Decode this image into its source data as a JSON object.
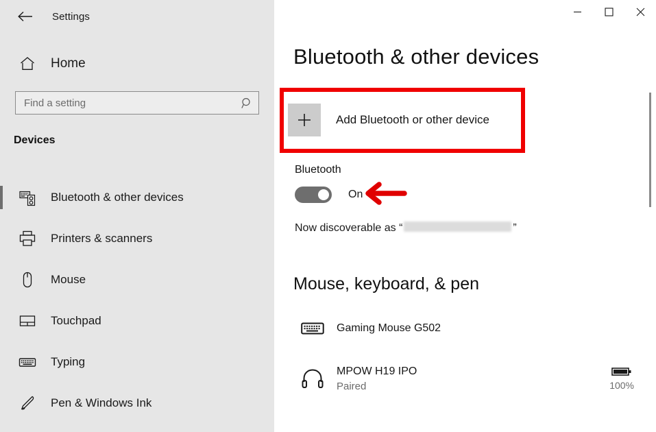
{
  "window": {
    "app_title": "Settings",
    "back_icon": "back-arrow-icon",
    "controls": [
      {
        "name": "minimize",
        "glyph": "─"
      },
      {
        "name": "maximize",
        "glyph": "□"
      },
      {
        "name": "close",
        "glyph": "✕"
      }
    ]
  },
  "sidebar": {
    "home_label": "Home",
    "home_icon": "home-icon",
    "search": {
      "placeholder": "Find a setting",
      "value": "",
      "icon": "search-icon"
    },
    "category": "Devices",
    "items": [
      {
        "label": "Bluetooth & other devices",
        "icon": "bluetooth-devices-icon",
        "selected": true
      },
      {
        "label": "Printers & scanners",
        "icon": "printer-icon",
        "selected": false
      },
      {
        "label": "Mouse",
        "icon": "mouse-icon",
        "selected": false
      },
      {
        "label": "Touchpad",
        "icon": "touchpad-icon",
        "selected": false
      },
      {
        "label": "Typing",
        "icon": "keyboard-icon",
        "selected": false
      },
      {
        "label": "Pen & Windows Ink",
        "icon": "pen-icon",
        "selected": false
      }
    ]
  },
  "main": {
    "page_title": "Bluetooth & other devices",
    "add_device": {
      "label": "Add Bluetooth or other device",
      "icon": "plus-icon"
    },
    "bluetooth": {
      "section_label": "Bluetooth",
      "toggle_state": "On",
      "discoverable_prefix": "Now discoverable as “",
      "discoverable_suffix": "”"
    },
    "devices_section": {
      "title": "Mouse, keyboard, & pen",
      "items": [
        {
          "name": "Gaming Mouse G502",
          "status": "",
          "icon": "keyboard-icon",
          "battery": ""
        },
        {
          "name": "MPOW H19 IPO",
          "status": "Paired",
          "icon": "headphones-icon",
          "battery": "100%"
        }
      ]
    }
  },
  "annotations": {
    "highlight_color": "#f00000",
    "arrow_color": "#e00000",
    "highlight_target": "add-device-button",
    "arrow_target": "bluetooth-toggle"
  }
}
